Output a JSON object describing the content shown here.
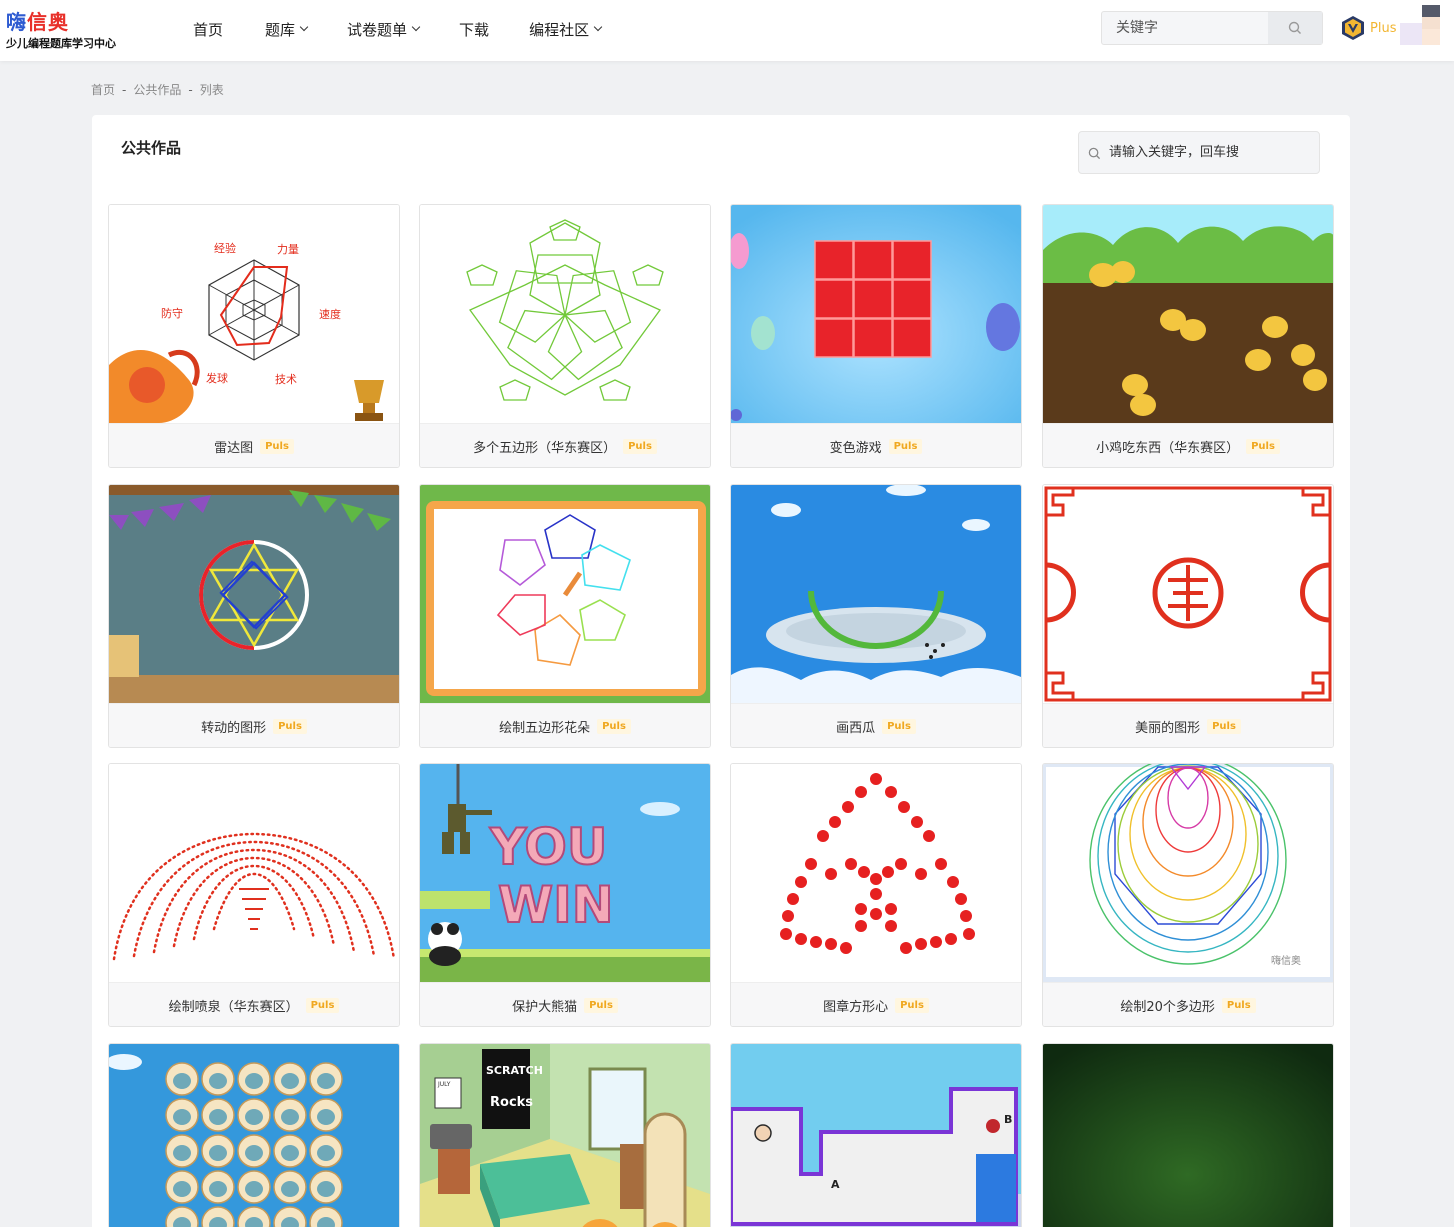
{
  "logo": {
    "main_a": "嗨",
    "main_b": "信奥",
    "sub": "少儿编程题库学习中心"
  },
  "nav": [
    {
      "label": "首页"
    },
    {
      "label": "题库"
    },
    {
      "label": "试卷题单"
    },
    {
      "label": "下载"
    },
    {
      "label": "编程社区"
    }
  ],
  "search": {
    "placeholder": "关键字"
  },
  "user": {
    "plus": "Plus"
  },
  "breadcrumb": [
    "首页",
    "公共作品",
    "列表"
  ],
  "panel": {
    "title": "公共作品",
    "search_placeholder": "请输入关键字，回车搜"
  },
  "badge": "Puls",
  "radar": {
    "labels": [
      "经验",
      "力量",
      "速度",
      "技术",
      "发球",
      "防守"
    ]
  },
  "cards": [
    {
      "title": "雷达图"
    },
    {
      "title": "多个五边形（华东赛区）"
    },
    {
      "title": "变色游戏"
    },
    {
      "title": "小鸡吃东西（华东赛区）"
    },
    {
      "title": "转动的图形"
    },
    {
      "title": "绘制五边形花朵"
    },
    {
      "title": "画西瓜"
    },
    {
      "title": "美丽的图形"
    },
    {
      "title": "绘制喷泉（华东赛区）"
    },
    {
      "title": "保护大熊猫"
    },
    {
      "title": "图章方形心"
    },
    {
      "title": "绘制20个多边形"
    },
    {
      "title": ""
    },
    {
      "title": ""
    },
    {
      "title": ""
    },
    {
      "title": ""
    }
  ],
  "thumb_text": {
    "you": "YOU",
    "win": "WIN",
    "watermark": "嗨信奥",
    "scratch": "SCRATCH",
    "rocks": "Rocks",
    "july": "JULY",
    "point_a": "A",
    "point_b": "B"
  },
  "colors": {
    "accent": "#f2b632",
    "brand_red": "#e8302a",
    "brand_blue": "#2d5bd1"
  }
}
